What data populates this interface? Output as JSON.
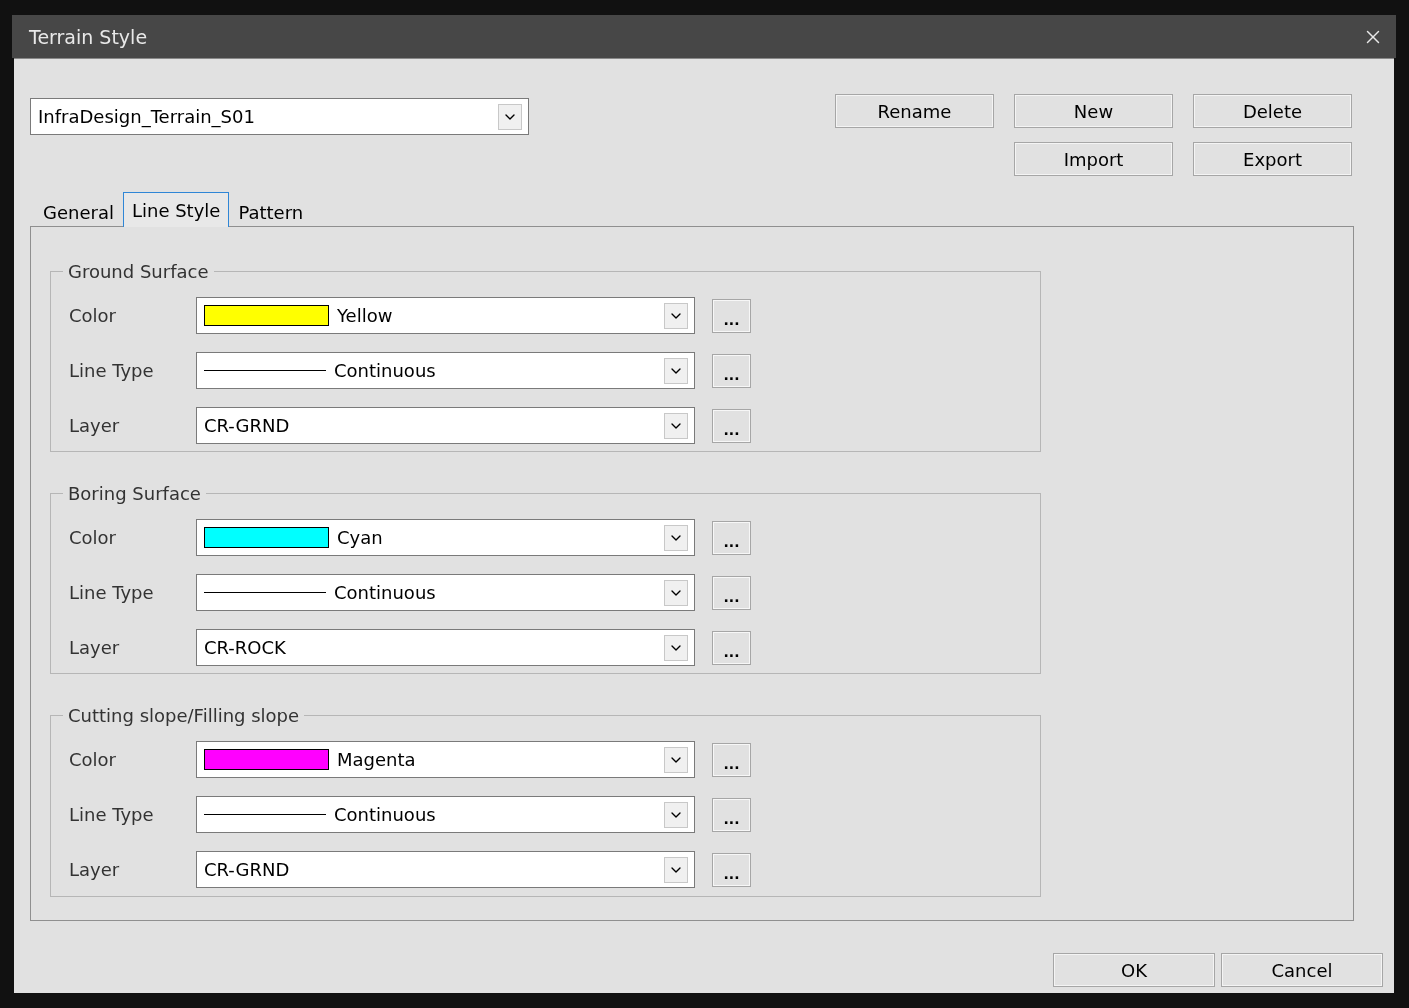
{
  "window": {
    "title": "Terrain Style"
  },
  "style_select": {
    "value": "InfraDesign_Terrain_S01"
  },
  "action_buttons": [
    [
      "Rename",
      "New",
      "Delete"
    ],
    [
      "Import",
      "Export"
    ]
  ],
  "tabs": [
    {
      "label": "General",
      "selected": false
    },
    {
      "label": "Line Style",
      "selected": true
    },
    {
      "label": "Pattern",
      "selected": false
    }
  ],
  "groups": [
    {
      "title": "Ground Surface",
      "rows": [
        {
          "kind": "color",
          "label": "Color",
          "value": "Yellow",
          "color": "#ffff00",
          "button": "..."
        },
        {
          "kind": "linetype",
          "label": "Line Type",
          "value": "Continuous",
          "button": "..."
        },
        {
          "kind": "text",
          "label": "Layer",
          "value": "CR-GRND",
          "button": "..."
        }
      ]
    },
    {
      "title": "Boring Surface",
      "rows": [
        {
          "kind": "color",
          "label": "Color",
          "value": "Cyan",
          "color": "#00ffff",
          "button": "..."
        },
        {
          "kind": "linetype",
          "label": "Line Type",
          "value": "Continuous",
          "button": "..."
        },
        {
          "kind": "text",
          "label": "Layer",
          "value": "CR-ROCK",
          "button": "..."
        }
      ]
    },
    {
      "title": "Cutting slope/Filling slope",
      "rows": [
        {
          "kind": "color",
          "label": "Color",
          "value": "Magenta",
          "color": "#ff00ff",
          "button": "..."
        },
        {
          "kind": "linetype",
          "label": "Line Type",
          "value": "Continuous",
          "button": "..."
        },
        {
          "kind": "text",
          "label": "Layer",
          "value": "CR-GRND",
          "button": "..."
        }
      ]
    }
  ],
  "footer_buttons": [
    "OK",
    "Cancel"
  ]
}
